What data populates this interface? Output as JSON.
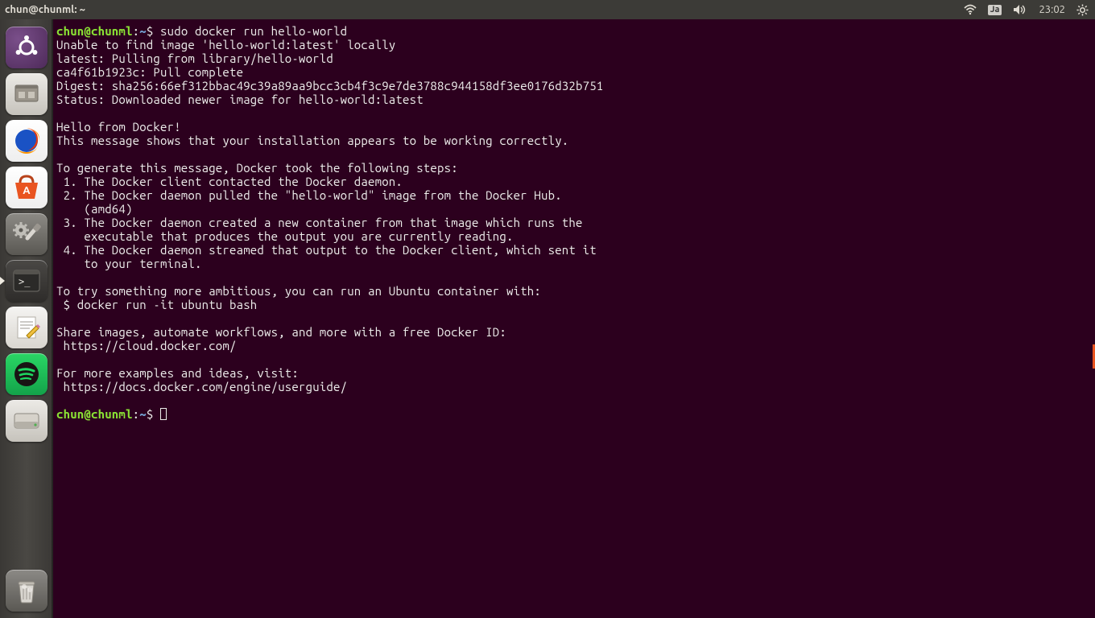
{
  "menubar": {
    "title": "chun@chunml: ~",
    "language_badge": "Ja",
    "clock": "23:02"
  },
  "launcher": {
    "items": [
      {
        "name": "dash-ubuntu-icon",
        "kind": "ubuntu"
      },
      {
        "name": "files-icon",
        "kind": "files"
      },
      {
        "name": "firefox-icon",
        "kind": "firefox"
      },
      {
        "name": "ubuntu-software-icon",
        "kind": "software"
      },
      {
        "name": "settings-icon",
        "kind": "settings"
      },
      {
        "name": "terminal-icon",
        "kind": "terminal-active",
        "active": true
      },
      {
        "name": "text-editor-icon",
        "kind": "text"
      },
      {
        "name": "spotify-icon",
        "kind": "spotify"
      },
      {
        "name": "external-disk-icon",
        "kind": "disk"
      }
    ],
    "trash": {
      "name": "trash-icon",
      "kind": "trash"
    }
  },
  "terminal": {
    "prompt": {
      "user_host": "chun@chunml",
      "colon": ":",
      "path": "~",
      "dollar": "$ "
    },
    "command": "sudo docker run hello-world",
    "output_lines": [
      "Unable to find image 'hello-world:latest' locally",
      "latest: Pulling from library/hello-world",
      "ca4f61b1923c: Pull complete",
      "Digest: sha256:66ef312bbac49c39a89aa9bcc3cb4f3c9e7de3788c944158df3ee0176d32b751",
      "Status: Downloaded newer image for hello-world:latest",
      "",
      "Hello from Docker!",
      "This message shows that your installation appears to be working correctly.",
      "",
      "To generate this message, Docker took the following steps:",
      " 1. The Docker client contacted the Docker daemon.",
      " 2. The Docker daemon pulled the \"hello-world\" image from the Docker Hub.",
      "    (amd64)",
      " 3. The Docker daemon created a new container from that image which runs the",
      "    executable that produces the output you are currently reading.",
      " 4. The Docker daemon streamed that output to the Docker client, which sent it",
      "    to your terminal.",
      "",
      "To try something more ambitious, you can run an Ubuntu container with:",
      " $ docker run -it ubuntu bash",
      "",
      "Share images, automate workflows, and more with a free Docker ID:",
      " https://cloud.docker.com/",
      "",
      "For more examples and ideas, visit:",
      " https://docs.docker.com/engine/userguide/",
      ""
    ]
  }
}
